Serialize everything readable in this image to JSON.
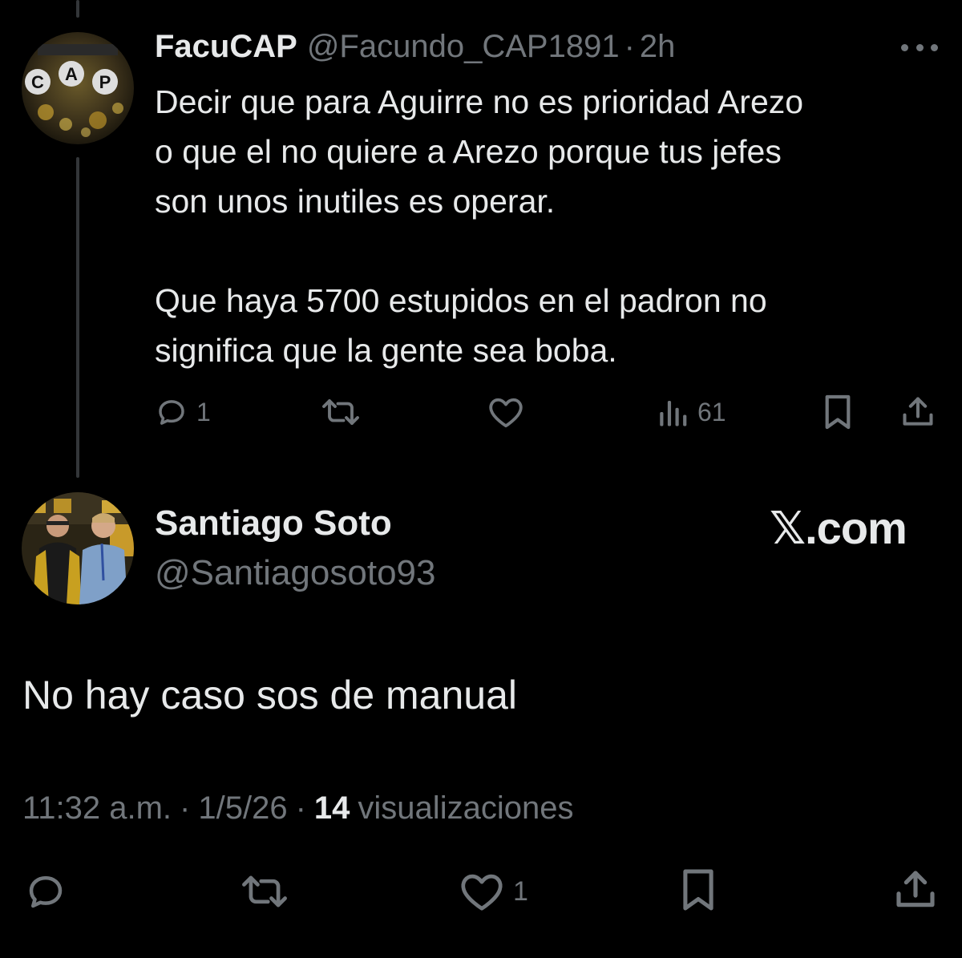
{
  "reply": {
    "name": "FacuCAP",
    "handle": "@Facundo_CAP1891",
    "separator": "·",
    "time": "2h",
    "text_line1": "Decir que para Aguirre no es prioridad Arezo",
    "text_line2": "o que el no quiere a Arezo porque tus jefes",
    "text_line3": "son unos inutiles es operar.",
    "text_line4": "Que haya 5700 estupidos en el padron no",
    "text_line5": "significa que la gente sea boba.",
    "actions": {
      "replies": "1",
      "reposts": "",
      "likes": "",
      "views": "61"
    },
    "avatar_text": "C A P"
  },
  "main_tweet": {
    "name": "Santiago Soto",
    "handle": "@Santiagosoto93",
    "text": "No hay caso sos de manual",
    "time": "11:32 a.m.",
    "separator": "·",
    "date": "1/5/26",
    "views_count": "14",
    "views_label": "visualizaciones",
    "actions": {
      "replies": "",
      "reposts": "",
      "likes": "1"
    }
  },
  "watermark": "𝕏.com",
  "colors": {
    "background": "#000000",
    "primary_text": "#e7e9ea",
    "secondary_text": "#71767b",
    "thread_line": "#333639"
  },
  "icons": {
    "more": "more-horizontal-icon",
    "reply": "speech-bubble-icon",
    "repost": "repost-arrows-icon",
    "like": "heart-icon",
    "views": "bar-chart-icon",
    "bookmark": "bookmark-icon",
    "share": "share-upload-icon"
  }
}
